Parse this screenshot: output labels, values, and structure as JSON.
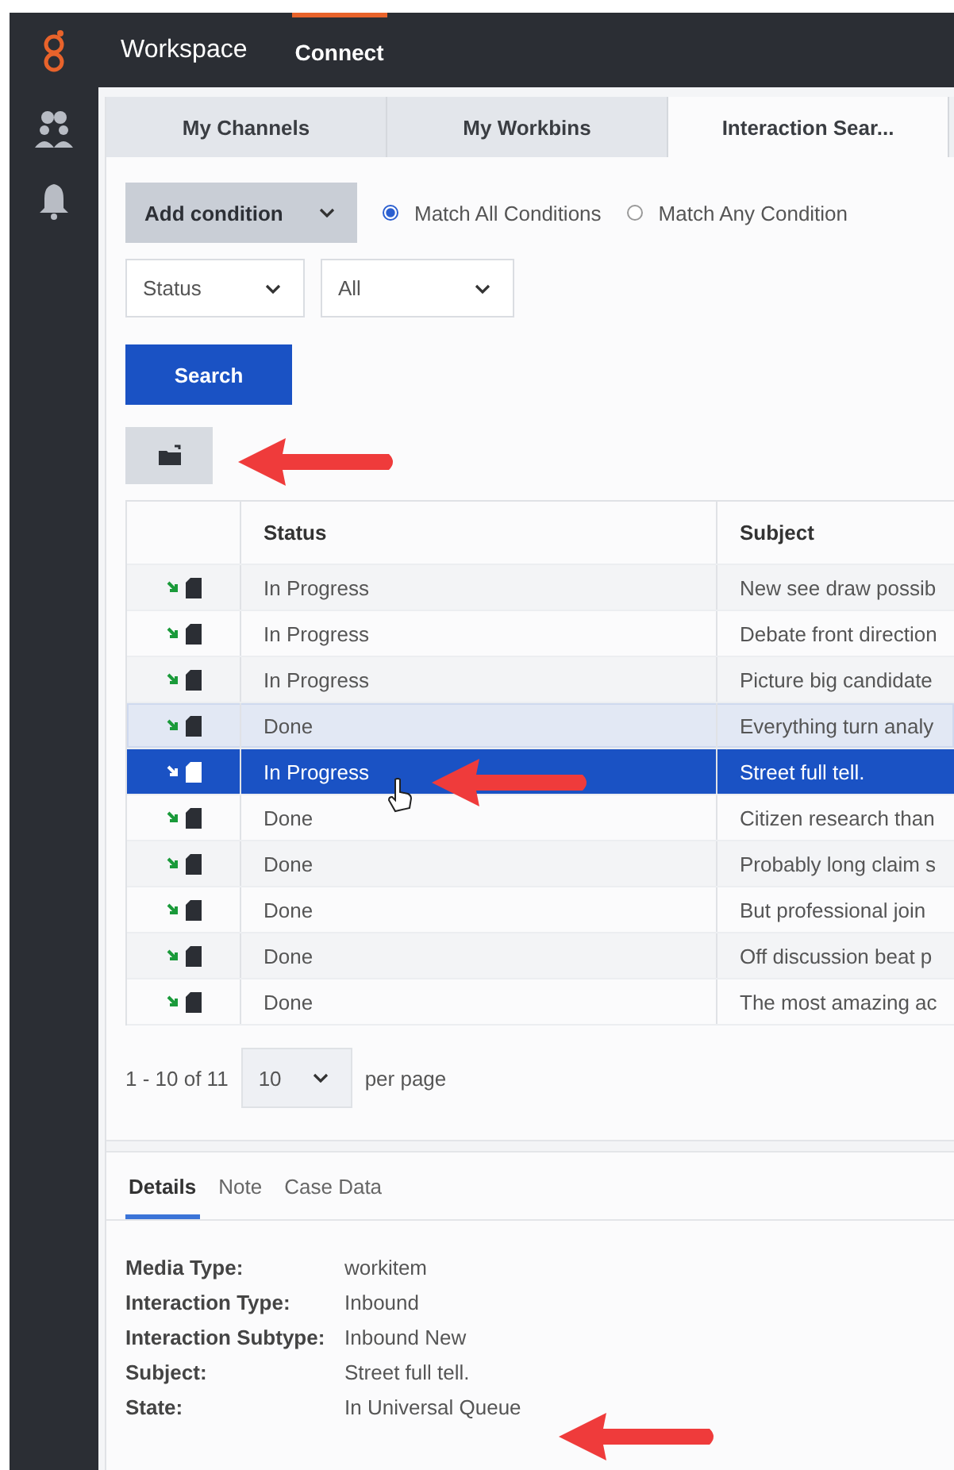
{
  "app_bar": {
    "title": "Workspace",
    "items": [
      {
        "label": "Connect",
        "selected": true
      }
    ]
  },
  "tabs": [
    {
      "label": "My Channels",
      "selected": false
    },
    {
      "label": "My Workbins",
      "selected": false
    },
    {
      "label": "Interaction Sear...",
      "selected": true
    }
  ],
  "search_form": {
    "add_condition": "Add condition",
    "match_options": [
      {
        "label": "Match All Conditions",
        "selected": true
      },
      {
        "label": "Match Any Condition",
        "selected": false
      }
    ],
    "field_select": "Status",
    "value_select": "All",
    "search_button": "Search"
  },
  "table": {
    "columns": [
      "Status",
      "Subject"
    ],
    "rows": [
      {
        "status": "In Progress",
        "subject": "New see draw possib",
        "selected": false,
        "highlighted": false
      },
      {
        "status": "In Progress",
        "subject": "Debate front direction",
        "selected": false,
        "highlighted": false
      },
      {
        "status": "In Progress",
        "subject": "Picture big candidate",
        "selected": false,
        "highlighted": false
      },
      {
        "status": "Done",
        "subject": "Everything turn analy",
        "selected": false,
        "highlighted": true
      },
      {
        "status": "In Progress",
        "subject": "Street full tell.",
        "selected": true,
        "highlighted": false
      },
      {
        "status": "Done",
        "subject": "Citizen research than",
        "selected": false,
        "highlighted": false
      },
      {
        "status": "Done",
        "subject": "Probably long claim s",
        "selected": false,
        "highlighted": false
      },
      {
        "status": "Done",
        "subject": "But professional join",
        "selected": false,
        "highlighted": false
      },
      {
        "status": "Done",
        "subject": "Off discussion beat p",
        "selected": false,
        "highlighted": false
      },
      {
        "status": "Done",
        "subject": "The most amazing ac",
        "selected": false,
        "highlighted": false
      }
    ]
  },
  "pagination": {
    "range": "1 - 10 of 11",
    "page_size": "10",
    "suffix": "per page"
  },
  "detail_tabs": [
    {
      "label": "Details",
      "selected": true
    },
    {
      "label": "Note",
      "selected": false
    },
    {
      "label": "Case Data",
      "selected": false
    }
  ],
  "details": [
    {
      "label": "Media Type:",
      "value": "workitem"
    },
    {
      "label": "Interaction Type:",
      "value": "Inbound"
    },
    {
      "label": "Interaction Subtype:",
      "value": "Inbound New"
    },
    {
      "label": "Subject:",
      "value": "Street full tell."
    },
    {
      "label": "State:",
      "value": "In Universal Queue"
    }
  ]
}
